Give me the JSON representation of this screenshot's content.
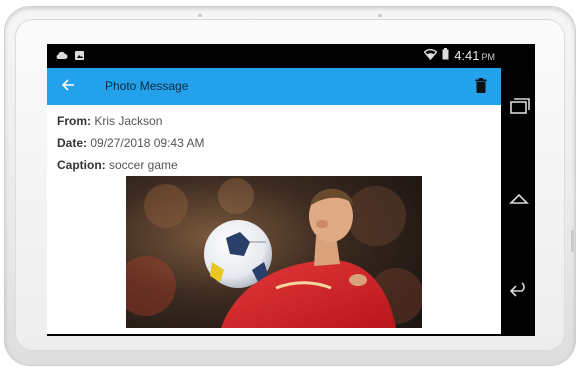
{
  "status_bar": {
    "time": "4:41",
    "ampm": "PM",
    "left_icons": [
      "cloud-icon",
      "image-notification-icon"
    ],
    "right_icons": [
      "wifi-icon",
      "battery-icon"
    ]
  },
  "app_bar": {
    "title": "Photo Message",
    "back_icon": "arrow-left-icon",
    "delete_icon": "trash-icon",
    "color": "#23a1ea"
  },
  "message": {
    "from_label": "From:",
    "from_value": "Kris Jackson",
    "date_label": "Date:",
    "date_value": "09/27/2018 09:43 AM",
    "caption_label": "Caption:",
    "caption_value": "soccer game"
  },
  "nav_bar": {
    "buttons": [
      "recent-apps-icon",
      "home-icon",
      "back-icon"
    ]
  }
}
